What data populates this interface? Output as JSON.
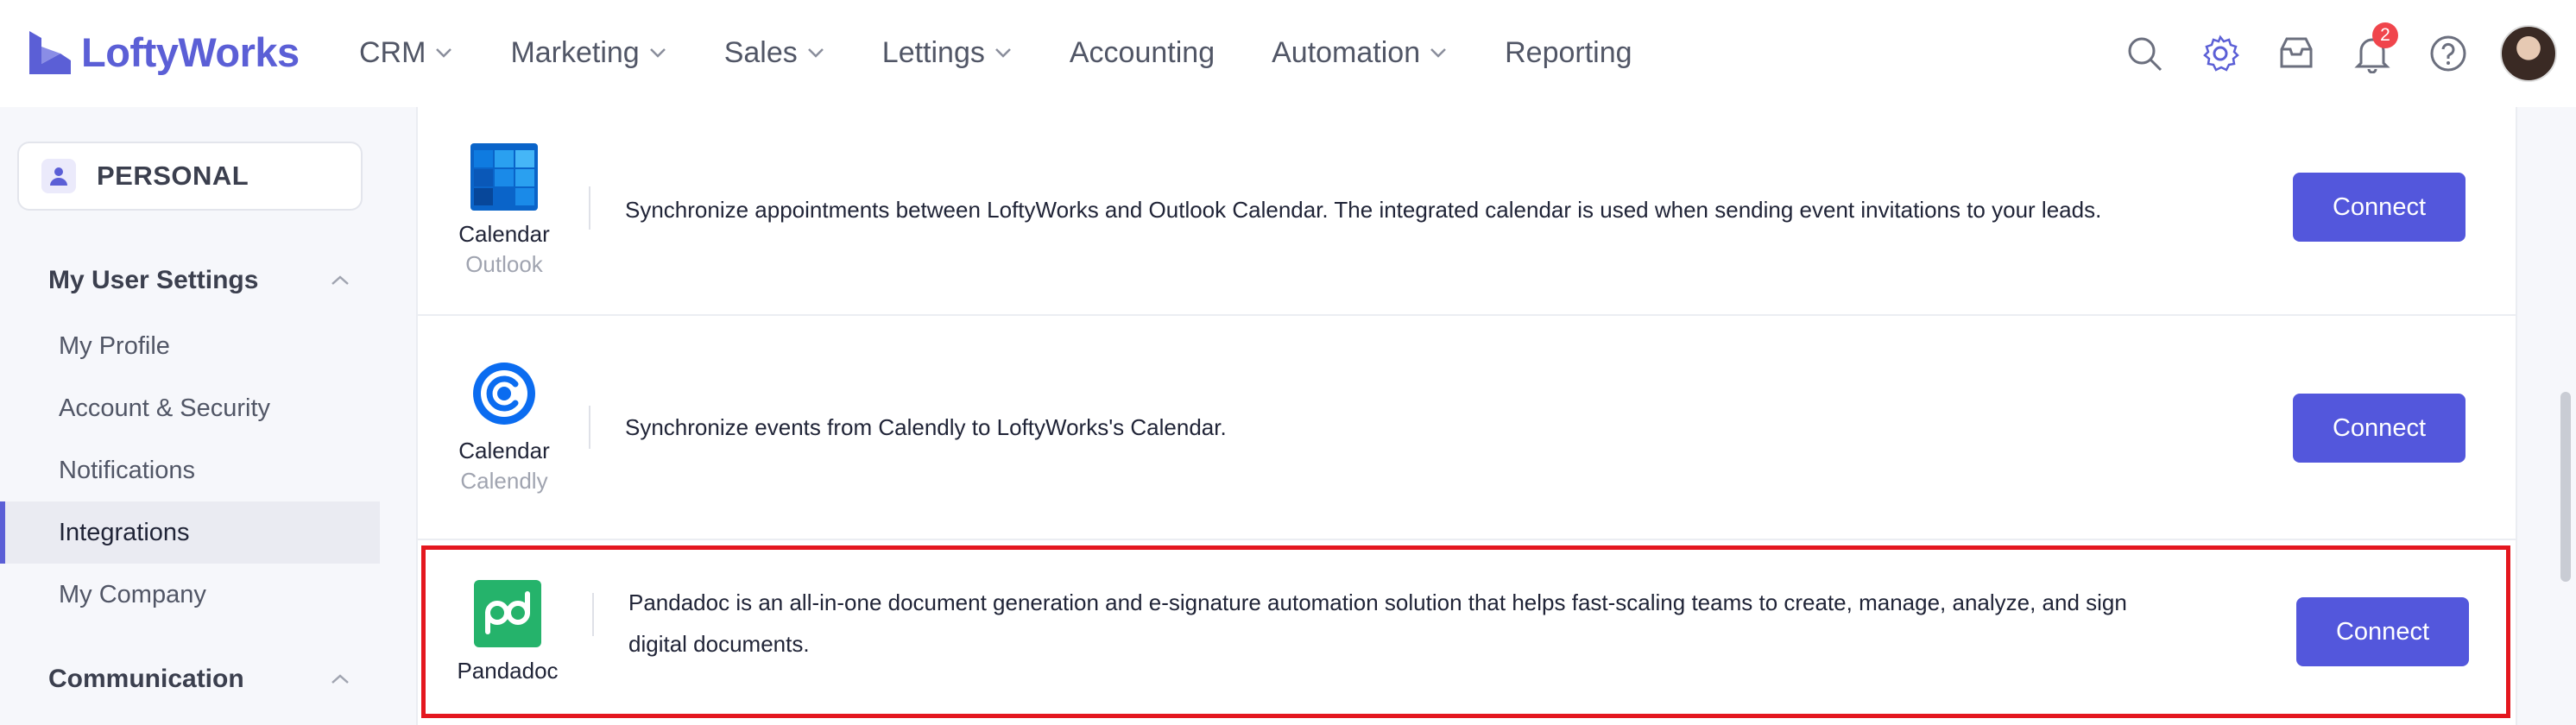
{
  "brand": {
    "name": "LoftyWorks",
    "color": "#5b5fd6"
  },
  "nav": {
    "items": [
      {
        "label": "CRM",
        "has_dropdown": true
      },
      {
        "label": "Marketing",
        "has_dropdown": true
      },
      {
        "label": "Sales",
        "has_dropdown": true
      },
      {
        "label": "Lettings",
        "has_dropdown": true
      },
      {
        "label": "Accounting",
        "has_dropdown": false
      },
      {
        "label": "Automation",
        "has_dropdown": true
      },
      {
        "label": "Reporting",
        "has_dropdown": false
      }
    ],
    "icons": [
      "search-icon",
      "gear-icon",
      "inbox-icon",
      "bell-icon",
      "help-icon",
      "avatar"
    ],
    "notification_count": "2"
  },
  "sidebar": {
    "scope": "PERSONAL",
    "sections": [
      {
        "title": "My User Settings",
        "items": [
          "My Profile",
          "Account & Security",
          "Notifications",
          "Integrations",
          "My Company"
        ]
      },
      {
        "title": "Communication",
        "items": []
      }
    ],
    "active_item": "Integrations"
  },
  "integrations": [
    {
      "name": "Calendar",
      "provider": "Outlook",
      "icon": "outlook-calendar-icon",
      "description": "Synchronize appointments between LoftyWorks and Outlook Calendar. The integrated calendar is used when sending event invitations to your leads.",
      "action": "Connect"
    },
    {
      "name": "Calendar",
      "provider": "Calendly",
      "icon": "calendly-icon",
      "description": "Synchronize events from Calendly to LoftyWorks's Calendar.",
      "action": "Connect"
    },
    {
      "name": "Pandadoc",
      "provider": "",
      "icon": "pandadoc-icon",
      "description_line1": "Pandadoc is an all-in-one document generation and e-signature automation solution that helps fast-scaling teams to create, manage, analyze, and sign",
      "description_line2": "digital documents.",
      "action": "Connect",
      "highlighted": true
    }
  ],
  "colors": {
    "accent": "#5357dc",
    "highlight_border": "#e4171f",
    "badge": "#f0454c"
  }
}
